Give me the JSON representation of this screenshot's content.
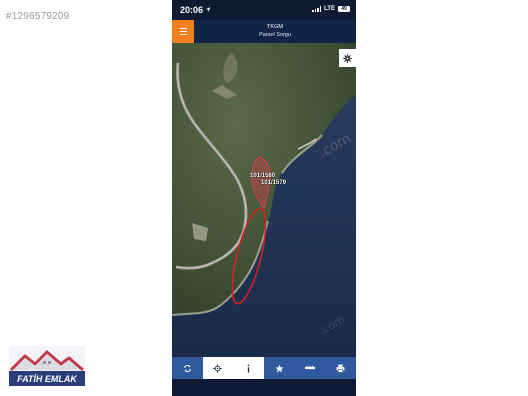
{
  "listing_id": "#1296579209",
  "status_bar": {
    "time": "20:06",
    "network": "LTE",
    "battery": "49"
  },
  "header": {
    "title": "TKGM",
    "subtitle": "Parsel Sorgu"
  },
  "map": {
    "parcel_label_1": "101/1580",
    "parcel_label_2": "101/1579"
  },
  "toolbar": {
    "items": [
      {
        "name": "refresh",
        "icon": "refresh-icon",
        "style": "blue"
      },
      {
        "name": "locate",
        "icon": "crosshair-icon",
        "style": "white"
      },
      {
        "name": "info",
        "icon": "info-icon",
        "style": "white"
      },
      {
        "name": "favorite",
        "icon": "star-icon",
        "style": "blue"
      },
      {
        "name": "measure",
        "icon": "ruler-icon",
        "style": "blue"
      },
      {
        "name": "print",
        "icon": "print-icon",
        "style": "blue"
      }
    ]
  },
  "logo": {
    "text": "FATİH EMLAK"
  },
  "colors": {
    "accent": "#f07f1c",
    "header": "#102448",
    "toolbar_blue": "#2f5a9e",
    "parcel": "#e03a4a",
    "highlight": "#e02020"
  }
}
